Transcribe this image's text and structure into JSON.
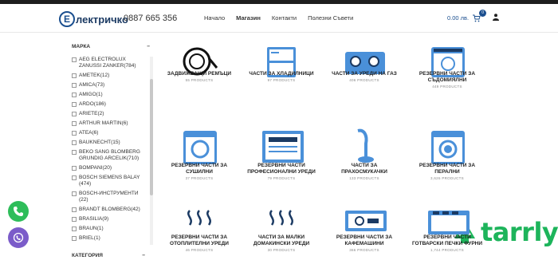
{
  "header": {
    "logo_letter": "Е",
    "logo_text": "лектричко",
    "phone": "0887 665 356",
    "nav": [
      "Начало",
      "Магазин",
      "Контакти",
      "Полезни Съвети"
    ],
    "cart_total": "0.00 лв.",
    "cart_count": "0"
  },
  "sidebar": {
    "brand_heading": "МАРКА",
    "category_heading": "КАТЕГОРИЯ",
    "collapse_symbol": "−",
    "brands": [
      "AEG ELECTROLUX ZANUSSI ZANKER(784)",
      "AMETEK(12)",
      "AMICA(73)",
      "AMIGO(1)",
      "ARDO(186)",
      "ARIETE(2)",
      "ARTHUR MARTIN(6)",
      "ATEA(6)",
      "BAUKNECHT(15)",
      "BEKO SANG BLOMBERG GRUNDIG ARCELIK(710)",
      "BOMPANI(20)",
      "BOSCH SIEMENS BALAY (474)",
      "BOSCH-ИНСТРУМЕНТИ (22)",
      "BRANDT BLOMBERG(42)",
      "BRASILIA(9)",
      "BRAUN(1)",
      "BRIEL(1)"
    ]
  },
  "categories": [
    {
      "title": "ЗАДВИЖВАЩИ РЕМЪЦИ",
      "count": "55 PRODUCTS"
    },
    {
      "title": "ЧАСТИ ЗА ХЛАДИЛНИЦИ",
      "count": "97 PRODUCTS"
    },
    {
      "title": "ЧАСТИ ЗА УРЕДИ НА ГАЗ",
      "count": "406 PRODUCTS"
    },
    {
      "title": "РЕЗЕРВНИ ЧАСТИ ЗА СЪДОМИЯЛНИ",
      "count": "449 PRODUCTS"
    },
    {
      "title": "РЕЗЕРВНИ ЧАСТИ ЗА СУШИЛНИ",
      "count": "37 PRODUCTS"
    },
    {
      "title": "РЕЗЕРВНИ ЧАСТИ ПРОФЕСИОНАЛНИ УРЕДИ",
      "count": "79 PRODUCTS"
    },
    {
      "title": "ЧАСТИ ЗА ПРАХОСМУКАЧКИ",
      "count": "133 PRODUCTS"
    },
    {
      "title": "РЕЗЕРВНИ ЧАСТИ ЗА ПЕРАЛНИ",
      "count": "3,626 PRODUCTS"
    },
    {
      "title": "РЕЗЕРВНИ ЧАСТИ ЗА ОТОПЛИТЕЛНИ УРЕДИ",
      "count": "46 PRODUCTS"
    },
    {
      "title": "ЧАСТИ ЗА МАЛКИ ДОМАКИНСКИ УРЕДИ",
      "count": "30 PRODUCTS"
    },
    {
      "title": "РЕЗЕРВНИ ЧАСТИ ЗА КАФЕМАШИНИ",
      "count": "366 PRODUCTS"
    },
    {
      "title": "РЕЗЕРВНИ ЧАСТИ ГОТВАРСКИ ПЕЧКИ ФУРНИ",
      "count": "1,744 PRODUCTS"
    }
  ],
  "watermark": "tarrly",
  "colors": {
    "brand": "#1b4f8f",
    "icon_fill": "#4a90d9",
    "whatsapp": "#2ebd5a",
    "viber": "#7b5cc9",
    "tarrly": "#1db45b"
  }
}
